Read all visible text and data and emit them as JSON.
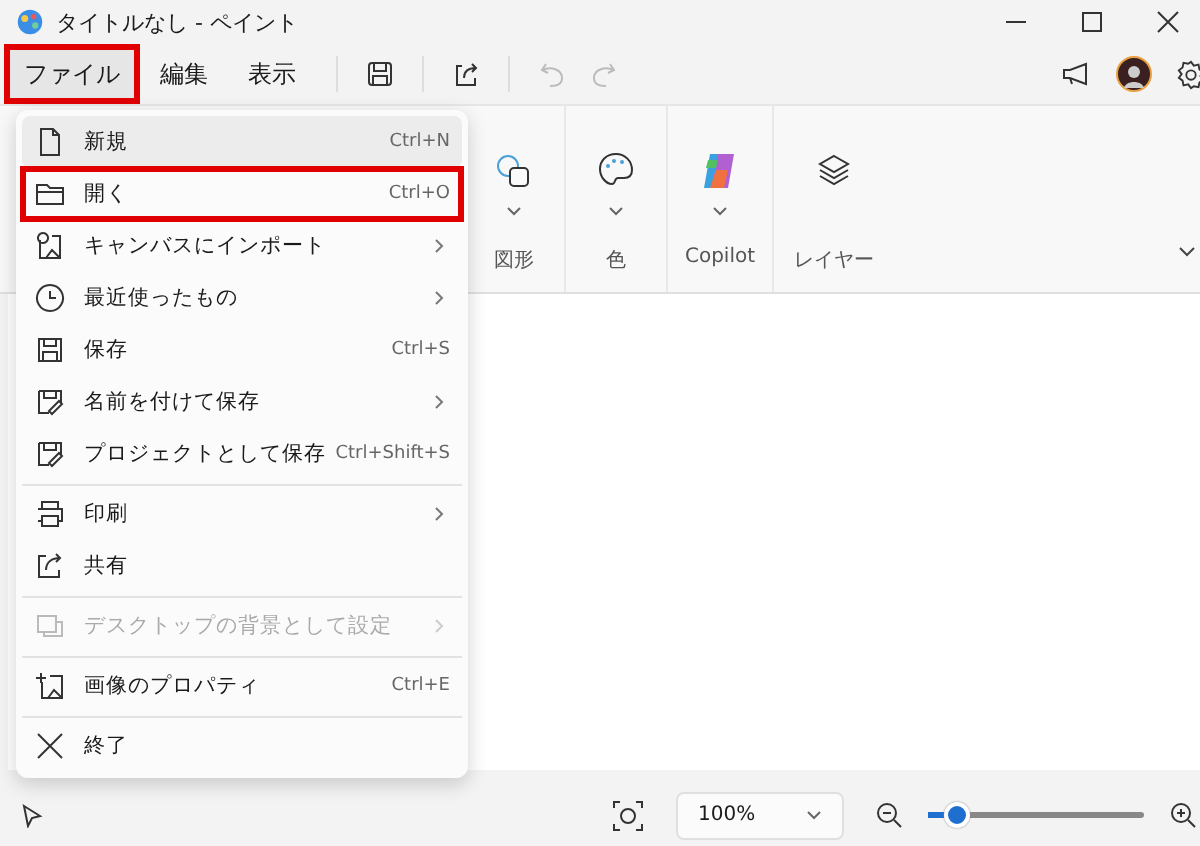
{
  "window": {
    "title": "タイトルなし - ペイント"
  },
  "menubar": [
    {
      "label": "ファイル",
      "selected": true,
      "highlighted": true
    },
    {
      "label": "編集",
      "selected": false,
      "highlighted": false
    },
    {
      "label": "表示",
      "selected": false,
      "highlighted": false
    }
  ],
  "toolbar": [
    {
      "kind": "save",
      "disabled": false
    },
    {
      "kind": "share",
      "disabled": false
    },
    {
      "kind": "undo",
      "disabled": true
    },
    {
      "kind": "redo",
      "disabled": true
    }
  ],
  "ribbon_groups": [
    {
      "kind": "shapes",
      "label": "図形",
      "dropdown": true
    },
    {
      "kind": "color",
      "label": "色",
      "dropdown": true
    },
    {
      "kind": "copilot",
      "label": "Copilot",
      "dropdown": true
    },
    {
      "kind": "layers",
      "label": "レイヤー",
      "dropdown": false
    }
  ],
  "file_menu": [
    {
      "label": "新規",
      "shortcut": "Ctrl+N",
      "submenu": false,
      "disabled": false,
      "hovered": true,
      "highlighted": false,
      "separator_before": false
    },
    {
      "label": "開く",
      "shortcut": "Ctrl+O",
      "submenu": false,
      "disabled": false,
      "hovered": false,
      "highlighted": true,
      "separator_before": false
    },
    {
      "label": "キャンバスにインポート",
      "submenu": true,
      "disabled": false,
      "hovered": false,
      "highlighted": false,
      "separator_before": false
    },
    {
      "label": "最近使ったもの",
      "submenu": true,
      "disabled": false,
      "hovered": false,
      "highlighted": false,
      "separator_before": false
    },
    {
      "label": "保存",
      "shortcut": "Ctrl+S",
      "submenu": false,
      "disabled": false,
      "hovered": false,
      "highlighted": false,
      "separator_before": false
    },
    {
      "label": "名前を付けて保存",
      "submenu": true,
      "disabled": false,
      "hovered": false,
      "highlighted": false,
      "separator_before": false
    },
    {
      "label": "プロジェクトとして保存",
      "shortcut": "Ctrl+Shift+S",
      "submenu": false,
      "disabled": false,
      "hovered": false,
      "highlighted": false,
      "separator_before": false
    },
    {
      "label": "印刷",
      "submenu": true,
      "disabled": false,
      "hovered": false,
      "highlighted": false,
      "separator_before": true
    },
    {
      "label": "共有",
      "submenu": false,
      "disabled": false,
      "hovered": false,
      "highlighted": false,
      "separator_before": false
    },
    {
      "label": "デスクトップの背景として設定",
      "submenu": true,
      "disabled": true,
      "hovered": false,
      "highlighted": false,
      "separator_before": true
    },
    {
      "label": "画像のプロパティ",
      "shortcut": "Ctrl+E",
      "submenu": false,
      "disabled": false,
      "hovered": false,
      "highlighted": false,
      "separator_before": true
    },
    {
      "label": "終了",
      "submenu": false,
      "disabled": false,
      "hovered": false,
      "highlighted": false,
      "separator_before": true
    }
  ],
  "status_bar": {
    "zoom": "100%",
    "zoom_slider": {
      "level": 0.12
    }
  }
}
